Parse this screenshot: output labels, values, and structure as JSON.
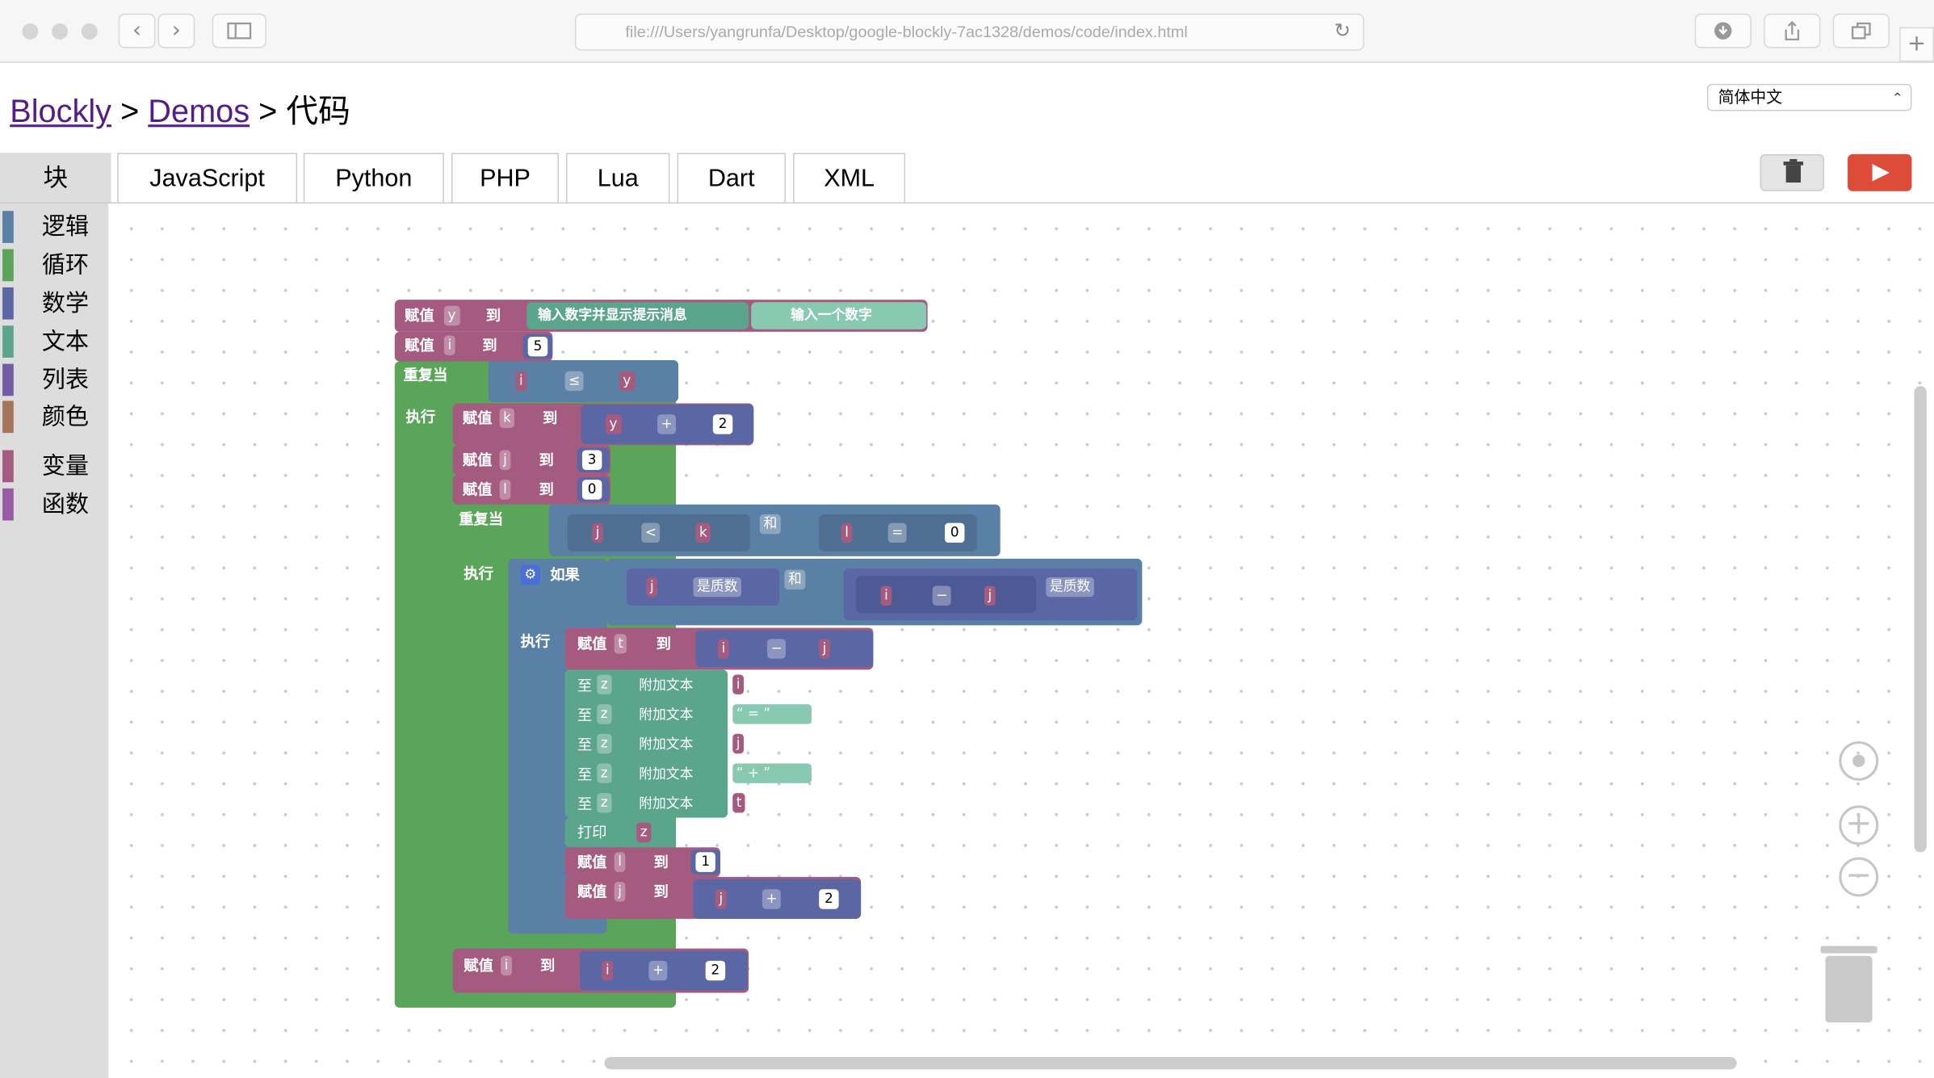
{
  "browser": {
    "url": "file:///Users/yangrunfa/Desktop/google-blockly-7ac1328/demos/code/index.html"
  },
  "breadcrumb": {
    "blockly": "Blockly",
    "sep1": ">",
    "demos": "Demos",
    "sep2": ">",
    "current": "代码"
  },
  "language_select": {
    "value": "简体中文"
  },
  "tabs": [
    {
      "label": "块"
    },
    {
      "label": "JavaScript"
    },
    {
      "label": "Python"
    },
    {
      "label": "PHP"
    },
    {
      "label": "Lua"
    },
    {
      "label": "Dart"
    },
    {
      "label": "XML"
    }
  ],
  "toolbox": {
    "categories": [
      {
        "label": "逻辑",
        "color": "#5b80a5"
      },
      {
        "label": "循环",
        "color": "#5ba55b"
      },
      {
        "label": "数学",
        "color": "#5b67a5"
      },
      {
        "label": "文本",
        "color": "#5ba58c"
      },
      {
        "label": "列表",
        "color": "#745ba5"
      },
      {
        "label": "颜色",
        "color": "#a5745b"
      },
      {
        "label": "变量",
        "color": "#a55b80"
      },
      {
        "label": "函数",
        "color": "#995ba5"
      }
    ]
  },
  "colors": {
    "variable": "#a55b80",
    "loop": "#5ba55b",
    "logic": "#5b80a5",
    "math": "#5b67a5",
    "text": "#5ba58c",
    "run": "#dd4b39"
  },
  "blocks": {
    "set_y": {
      "kw": "赋值",
      "var": "y",
      "to": "到",
      "prompt": "输入数字并显示提示消息",
      "text": "输入一个数字"
    },
    "set_i": {
      "kw": "赋值",
      "var": "i",
      "to": "到",
      "value": "5"
    },
    "while1": {
      "kw": "重复当",
      "a": "i",
      "op": "≤",
      "b": "y"
    },
    "do1": "执行",
    "set_k": {
      "kw": "赋值",
      "var": "k",
      "to": "到",
      "a": "y",
      "op": "+",
      "value": "2"
    },
    "set_j": {
      "kw": "赋值",
      "var": "j",
      "to": "到",
      "value": "3"
    },
    "set_l": {
      "kw": "赋值",
      "var": "l",
      "to": "到",
      "value": "0"
    },
    "while2": {
      "kw": "重复当",
      "a": "j",
      "op": "<",
      "b": "k",
      "and": "和",
      "c": "l",
      "op2": "=",
      "value": "0"
    },
    "do2": "执行",
    "if": {
      "kw": "如果",
      "a": "j",
      "is": "是质数",
      "and": "和",
      "b": "i",
      "op": "−",
      "c": "j",
      "is2": "是质数"
    },
    "do3": "执行",
    "set_t": {
      "kw": "赋值",
      "var": "t",
      "to": "到",
      "a": "i",
      "op": "−",
      "b": "j"
    },
    "append_rows": [
      {
        "prefix": "至",
        "var": "z",
        "label": "附加文本",
        "value": "i"
      },
      {
        "prefix": "至",
        "var": "z",
        "label": "附加文本",
        "value": "“ = ”"
      },
      {
        "prefix": "至",
        "var": "z",
        "label": "附加文本",
        "value": "j"
      },
      {
        "prefix": "至",
        "var": "z",
        "label": "附加文本",
        "value": "“ + ”"
      },
      {
        "prefix": "至",
        "var": "z",
        "label": "附加文本",
        "value": "t"
      }
    ],
    "print": {
      "kw": "打印",
      "var": "z"
    },
    "set_l1": {
      "kw": "赋值",
      "var": "l",
      "to": "到",
      "value": "1"
    },
    "set_j2": {
      "kw": "赋值",
      "var": "j",
      "to": "到",
      "a": "j",
      "op": "+",
      "value": "2"
    },
    "set_i2": {
      "kw": "赋值",
      "var": "i",
      "to": "到",
      "a": "i",
      "op": "+",
      "value": "2"
    }
  }
}
